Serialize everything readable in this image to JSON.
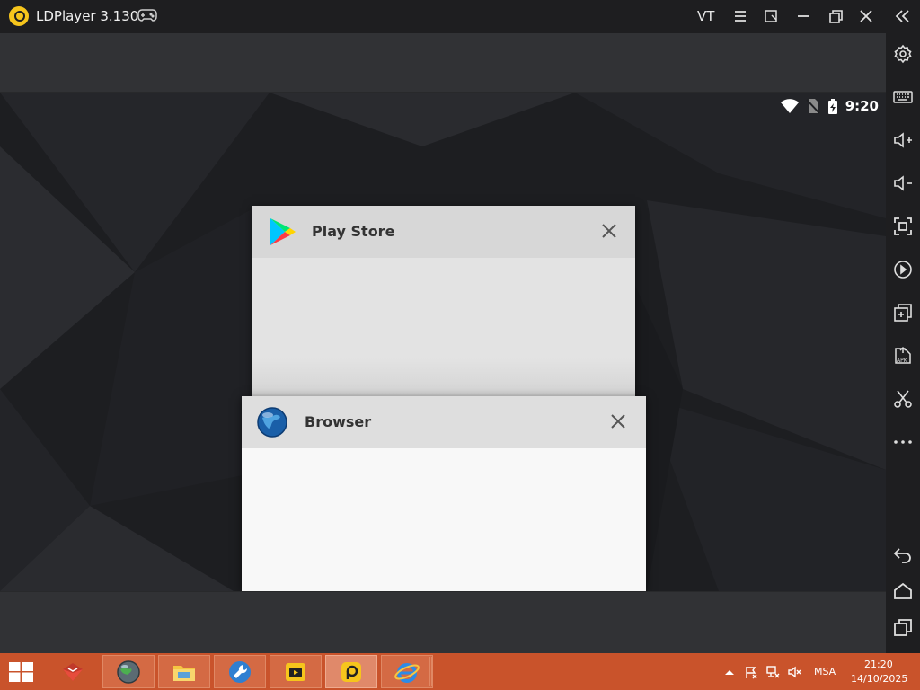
{
  "app": {
    "title": "LDPlayer 3.130",
    "vt_label": "VT",
    "accent": "#f6c51c"
  },
  "titlebar_buttons": [
    "menu-icon",
    "sync-window-icon",
    "minimize-icon",
    "restore-icon",
    "close-icon",
    "collapse-sidebar-icon"
  ],
  "android_status": {
    "time": "9:20",
    "icons": [
      "wifi-icon",
      "no-sim-icon",
      "battery-charging-icon"
    ]
  },
  "recent_apps": [
    {
      "name": "Play Store",
      "icon": "play-store-icon"
    },
    {
      "name": "Browser",
      "icon": "browser-globe-icon"
    }
  ],
  "sidebar_buttons": [
    "settings-icon",
    "keyboard-icon",
    "volume-up-icon",
    "volume-down-icon",
    "fullscreen-icon",
    "rotate-icon",
    "multi-instance-icon",
    "apk-install-icon",
    "screenshot-scissors-icon",
    "more-icon",
    "back-icon",
    "home-icon",
    "recents-icon"
  ],
  "taskbar": {
    "items": [
      "windows-start-icon",
      "app-shield-icon",
      "globe-app-icon",
      "file-explorer-icon",
      "tool-wrench-icon",
      "ldmultiplayer-icon",
      "ldplayer-icon",
      "internet-explorer-icon"
    ],
    "tray": {
      "language": "MSA",
      "time": "21:20",
      "date": "14/10/2025",
      "icons": [
        "chevron-up-icon",
        "flag-icon",
        "network-icon",
        "volume-muted-icon"
      ]
    },
    "color": "#c9532b"
  }
}
